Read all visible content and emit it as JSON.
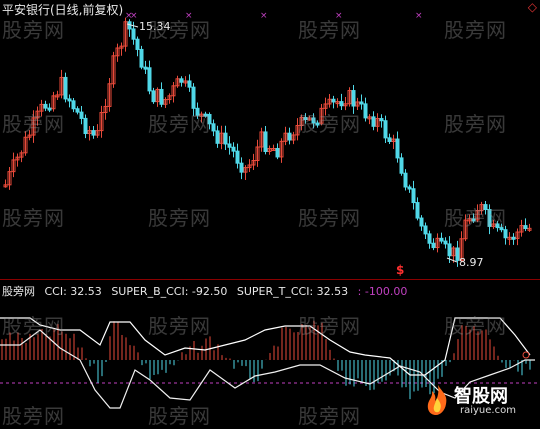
{
  "header": {
    "title": "平安银行(日线,前复权)"
  },
  "price_panel": {
    "high_label": "15.34",
    "low_label": "8.97",
    "signal_glyph": "$"
  },
  "indicator": {
    "name": "股旁网",
    "cci": "CCI: 32.53",
    "super_b": "SUPER_B_CCI: -92.50",
    "super_t": "SUPER_T_CCI: 32.53",
    "ref": ": -100.00"
  },
  "watermark": {
    "text": "股旁网"
  },
  "logo": {
    "main": "智股网",
    "sub": "raiyue.com"
  },
  "colors": {
    "up": "#e84a3a",
    "down": "#50d8e8",
    "super_line": "#f0f0f0",
    "ref_line": "#c040c0",
    "white_line": "#ffffff"
  }
}
